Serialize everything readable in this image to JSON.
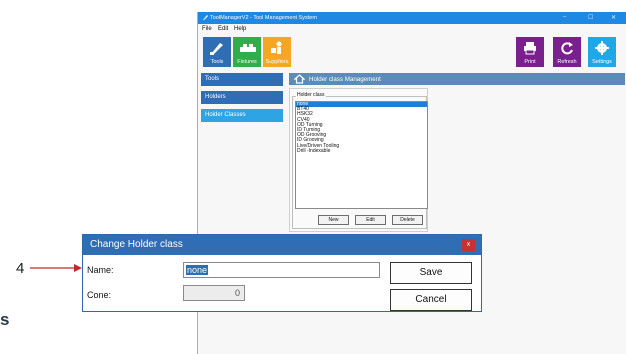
{
  "window": {
    "title": "ToolManagerV2 - Tool Management System",
    "controls": [
      "–",
      "☐",
      "✕"
    ]
  },
  "menu": [
    "File",
    "Edit",
    "Help"
  ],
  "toolbar": {
    "left_tiles": [
      {
        "label": "Tools",
        "color": "#2f6db5",
        "icon": "tools-icon"
      },
      {
        "label": "Fixtures",
        "color": "#2fae4a",
        "icon": "fixtures-icon"
      },
      {
        "label": "Suppliers",
        "color": "#f5a623",
        "icon": "suppliers-icon"
      }
    ],
    "right_tiles": [
      {
        "label": "Print",
        "color": "#7b1f8f",
        "icon": "print-icon"
      },
      {
        "label": "Refresh",
        "color": "#7b1f8f",
        "icon": "refresh-icon"
      },
      {
        "label": "Settings",
        "color": "#1fa8e8",
        "icon": "gear-icon"
      }
    ]
  },
  "sidebar": [
    {
      "label": "Tools",
      "active": false
    },
    {
      "label": "Holders",
      "active": false
    },
    {
      "label": "Holder Classes",
      "active": true
    }
  ],
  "content": {
    "header": "Holder class Management",
    "group_label": "Holder class",
    "items": [
      "none",
      "BT40",
      "HSK32",
      "CV40",
      "OD Turning",
      "ID Turning",
      "OD Grooving",
      "ID Grooving",
      "Live/Driven Tooling",
      "Drill -Indexable"
    ],
    "selected_index": 0,
    "buttons": {
      "new": "New",
      "edit": "Edit",
      "delete": "Delete"
    }
  },
  "dialog": {
    "title": "Change Holder class",
    "close": "x",
    "name_label": "Name:",
    "name_value": "none",
    "cone_label": "Cone:",
    "cone_value": "0",
    "save": "Save",
    "cancel": "Cancel"
  },
  "callout": {
    "number": "4"
  },
  "stray_text": "s"
}
